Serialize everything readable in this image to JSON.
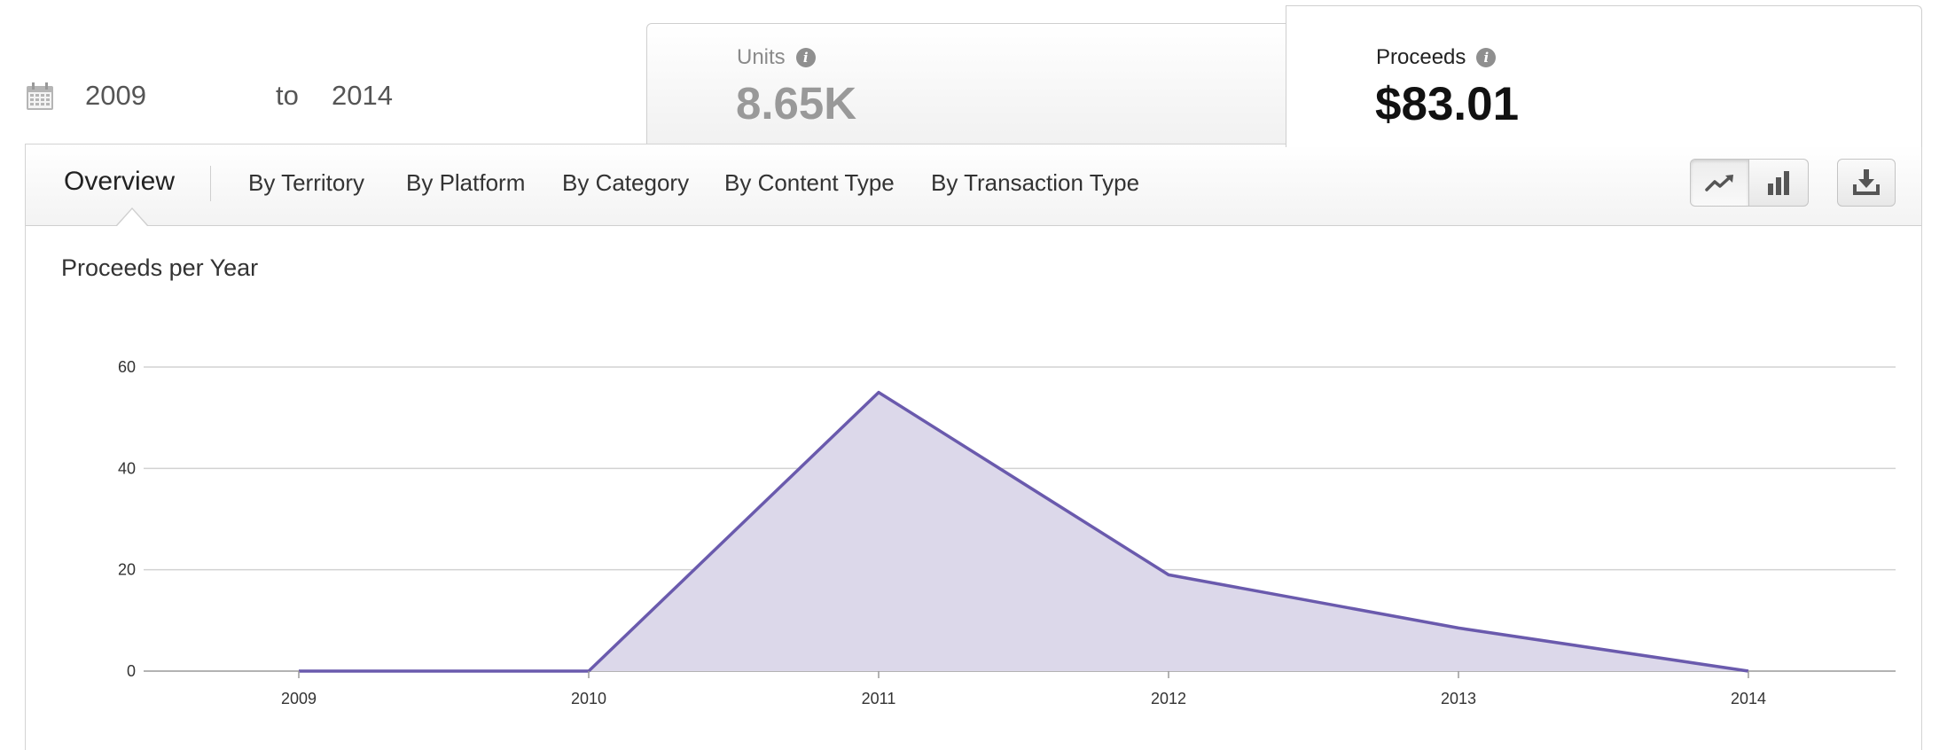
{
  "date_range": {
    "from": "2009",
    "separator": "to",
    "to": "2014",
    "icon": "calendar-icon"
  },
  "metrics": {
    "units": {
      "label": "Units",
      "value": "8.65K",
      "icon": "info-icon",
      "info_glyph": "i"
    },
    "proceeds": {
      "label": "Proceeds",
      "value": "$83.01",
      "icon": "info-icon",
      "info_glyph": "i",
      "selected": true
    }
  },
  "tabs": [
    {
      "label": "Overview",
      "active": true
    },
    {
      "label": "By Territory"
    },
    {
      "label": "By Platform"
    },
    {
      "label": "By Category"
    },
    {
      "label": "By Content Type"
    },
    {
      "label": "By Transaction Type"
    }
  ],
  "toolbar": {
    "line_chart_icon": "line-chart-icon",
    "bar_chart_icon": "bar-chart-icon",
    "download_icon": "download-icon",
    "selected_view": "line"
  },
  "chart_title": "Proceeds per Year",
  "chart_data": {
    "type": "area",
    "title": "Proceeds per Year",
    "categories": [
      "2009",
      "2010",
      "2011",
      "2012",
      "2013",
      "2014"
    ],
    "series": [
      {
        "values": [
          0,
          0,
          55,
          19,
          8.5,
          0
        ]
      }
    ],
    "y_ticks": [
      0,
      20,
      40,
      60
    ],
    "ylim": [
      0,
      60
    ],
    "grid": true,
    "line_color": "#6a5aad",
    "fill_color": "#dcd8ea"
  }
}
